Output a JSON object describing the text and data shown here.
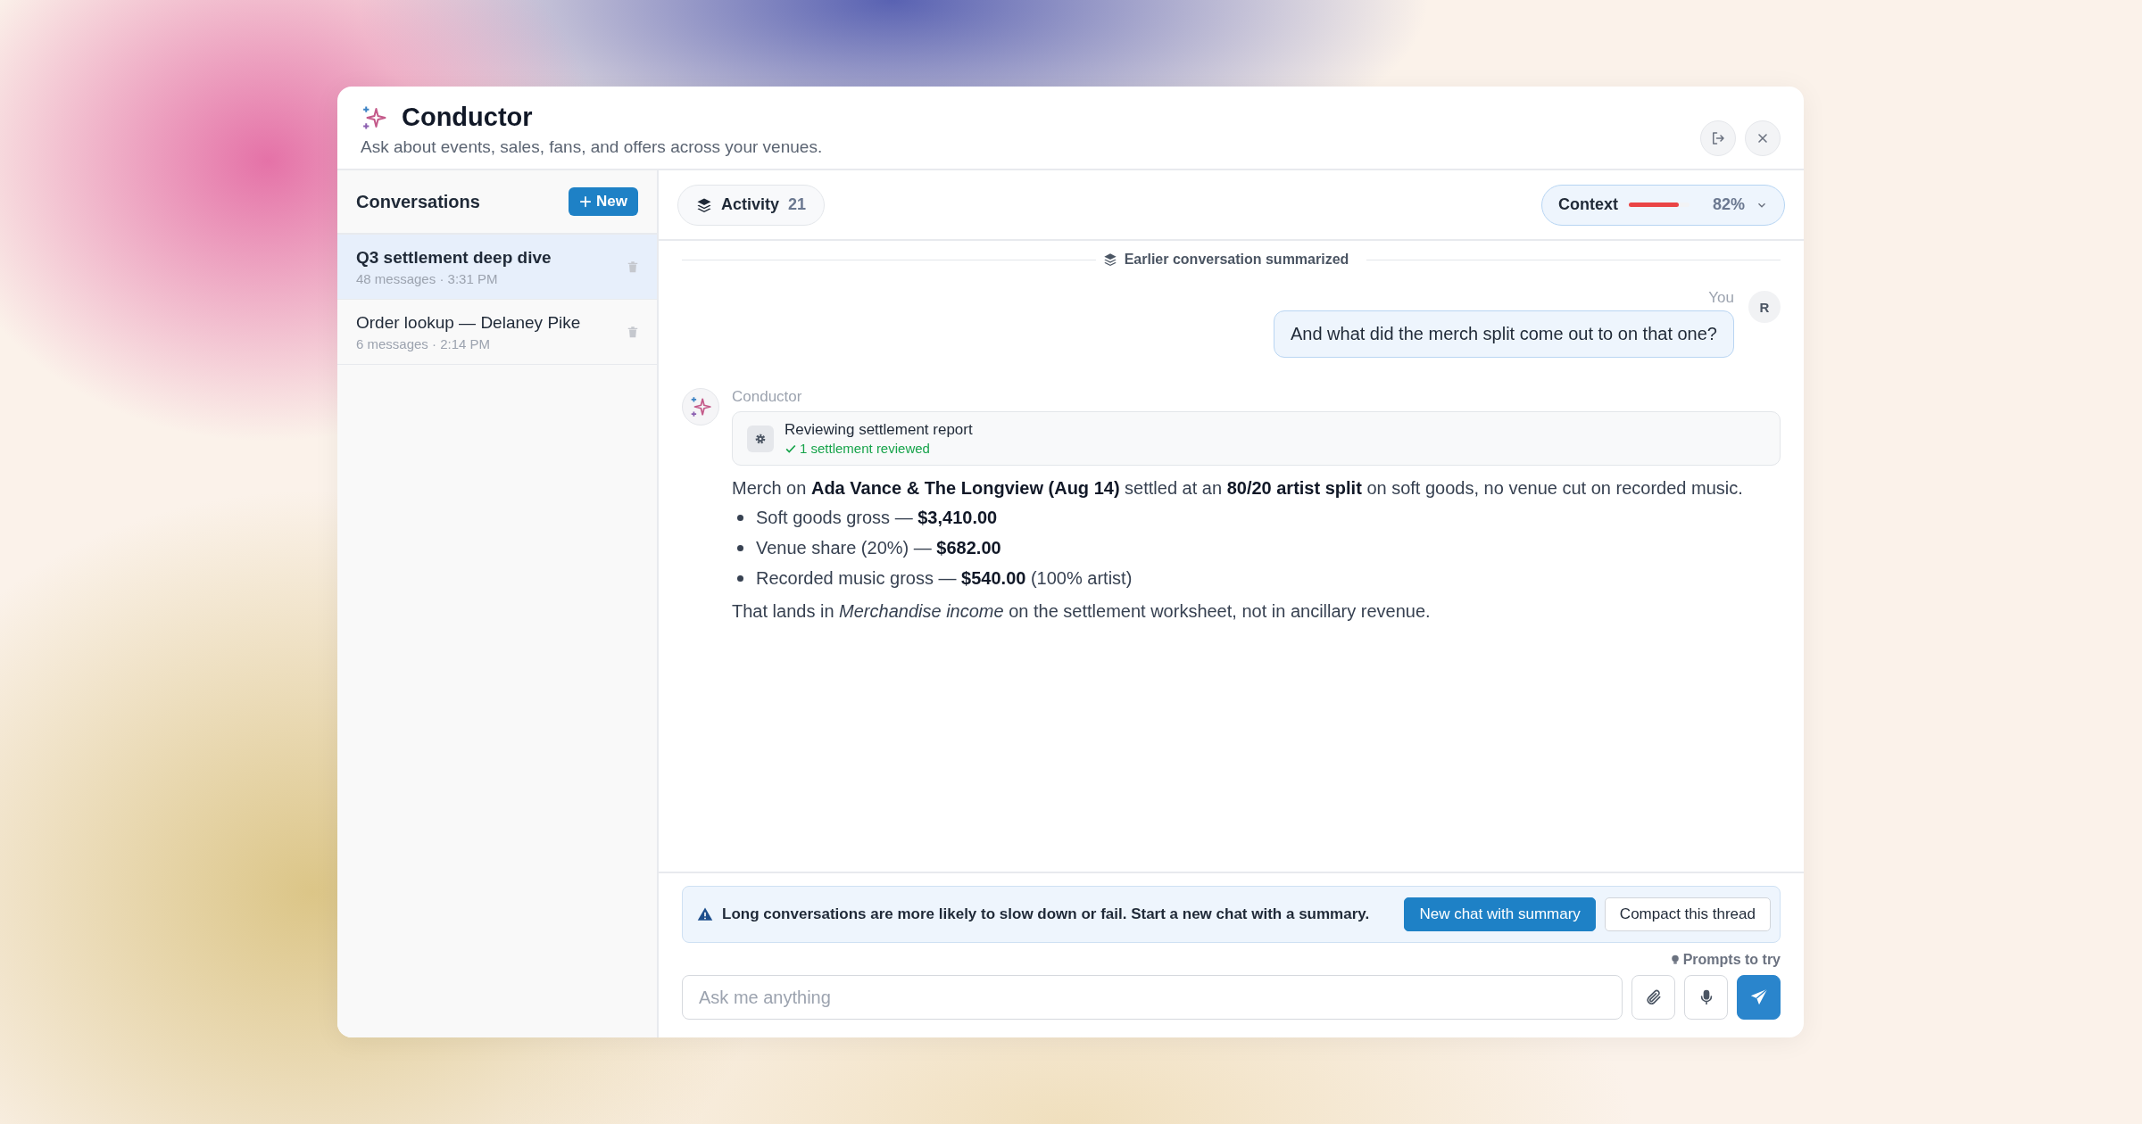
{
  "header": {
    "title": "Conductor",
    "subtitle": "Ask about events, sales, fans, and offers across your venues."
  },
  "sidebar": {
    "title": "Conversations",
    "new_button": "New",
    "items": [
      {
        "title": "Q3 settlement deep dive",
        "meta": "48 messages · 3:31 PM",
        "selected": true
      },
      {
        "title": "Order lookup — Delaney Pike",
        "meta": "6 messages · 2:14 PM",
        "selected": false
      }
    ]
  },
  "toolbar": {
    "activity_label": "Activity",
    "activity_count": "21",
    "context": {
      "label": "Context",
      "level": 0.82,
      "reading": "82%"
    }
  },
  "summary_note": "Earlier conversation summarized",
  "messages": [
    {
      "kind": "user",
      "author": "You",
      "avatar": "R",
      "text": "And what did the merch split come out to on that one?"
    },
    {
      "kind": "assistant",
      "author": "Conductor",
      "tool": {
        "title": "Reviewing settlement report",
        "status": "1 settlement reviewed"
      },
      "blocks": [
        {
          "kind": "paragraph",
          "text": "Merch on **Ada Vance & The Longview (Aug 14)** settled at an **80/20 artist split** on soft goods, no venue cut on recorded music."
        },
        {
          "kind": "list",
          "items": [
            "Soft goods gross — **$3,410.00**",
            "Venue share (20%) — **$682.00**",
            "Recorded music gross — **$540.00** (100% artist)"
          ]
        },
        {
          "kind": "paragraph",
          "text": "That lands in *Merchandise income* on the settlement worksheet, not in ancillary revenue."
        }
      ]
    }
  ],
  "warning": {
    "text": "Long conversations are more likely to slow down or fail. Start a new chat with a summary.",
    "buttons": [
      {
        "label": "New chat with summary",
        "kind": "primary"
      },
      {
        "label": "Compact this thread",
        "kind": "secondary"
      }
    ]
  },
  "prompts_link": "Prompts to try",
  "composer": {
    "placeholder": "Ask me anything"
  }
}
